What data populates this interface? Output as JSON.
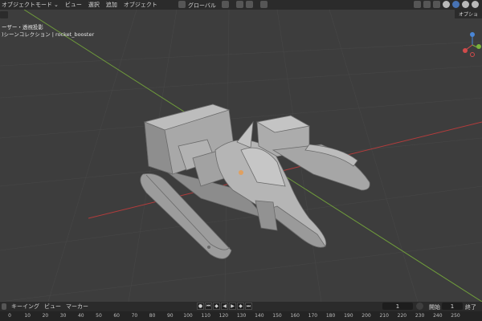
{
  "header": {
    "mode": "オブジェクトモード",
    "menus": [
      "ビュー",
      "選択",
      "追加",
      "オブジェクト"
    ],
    "orientation": "グローバル",
    "right_tab": "オプショ"
  },
  "viewport": {
    "view_label": "ーザー・透視投影",
    "collection_path": ")シーンコレクション | rocket_booster",
    "object_name": "rocket_booster"
  },
  "timeline": {
    "menus": [
      "キーイング",
      "ビュー",
      "マーカー"
    ],
    "current_frame": "1",
    "start_label": "開始",
    "start_frame": "1",
    "end_label": "終了",
    "ruler_ticks": [
      "0",
      "10",
      "20",
      "30",
      "40",
      "50",
      "60",
      "70",
      "80",
      "90",
      "100",
      "110",
      "120",
      "130",
      "140",
      "150",
      "160",
      "170",
      "180",
      "190",
      "200",
      "210",
      "220",
      "230",
      "240",
      "250"
    ]
  },
  "colors": {
    "background": "#3d3d3d",
    "header": "#2b2b2b",
    "x_axis": "#b33c3c",
    "y_axis": "#6f9c3b",
    "gizmo_x": "#d24b4b",
    "gizmo_y": "#7ab33b",
    "gizmo_z": "#4a86d6"
  }
}
